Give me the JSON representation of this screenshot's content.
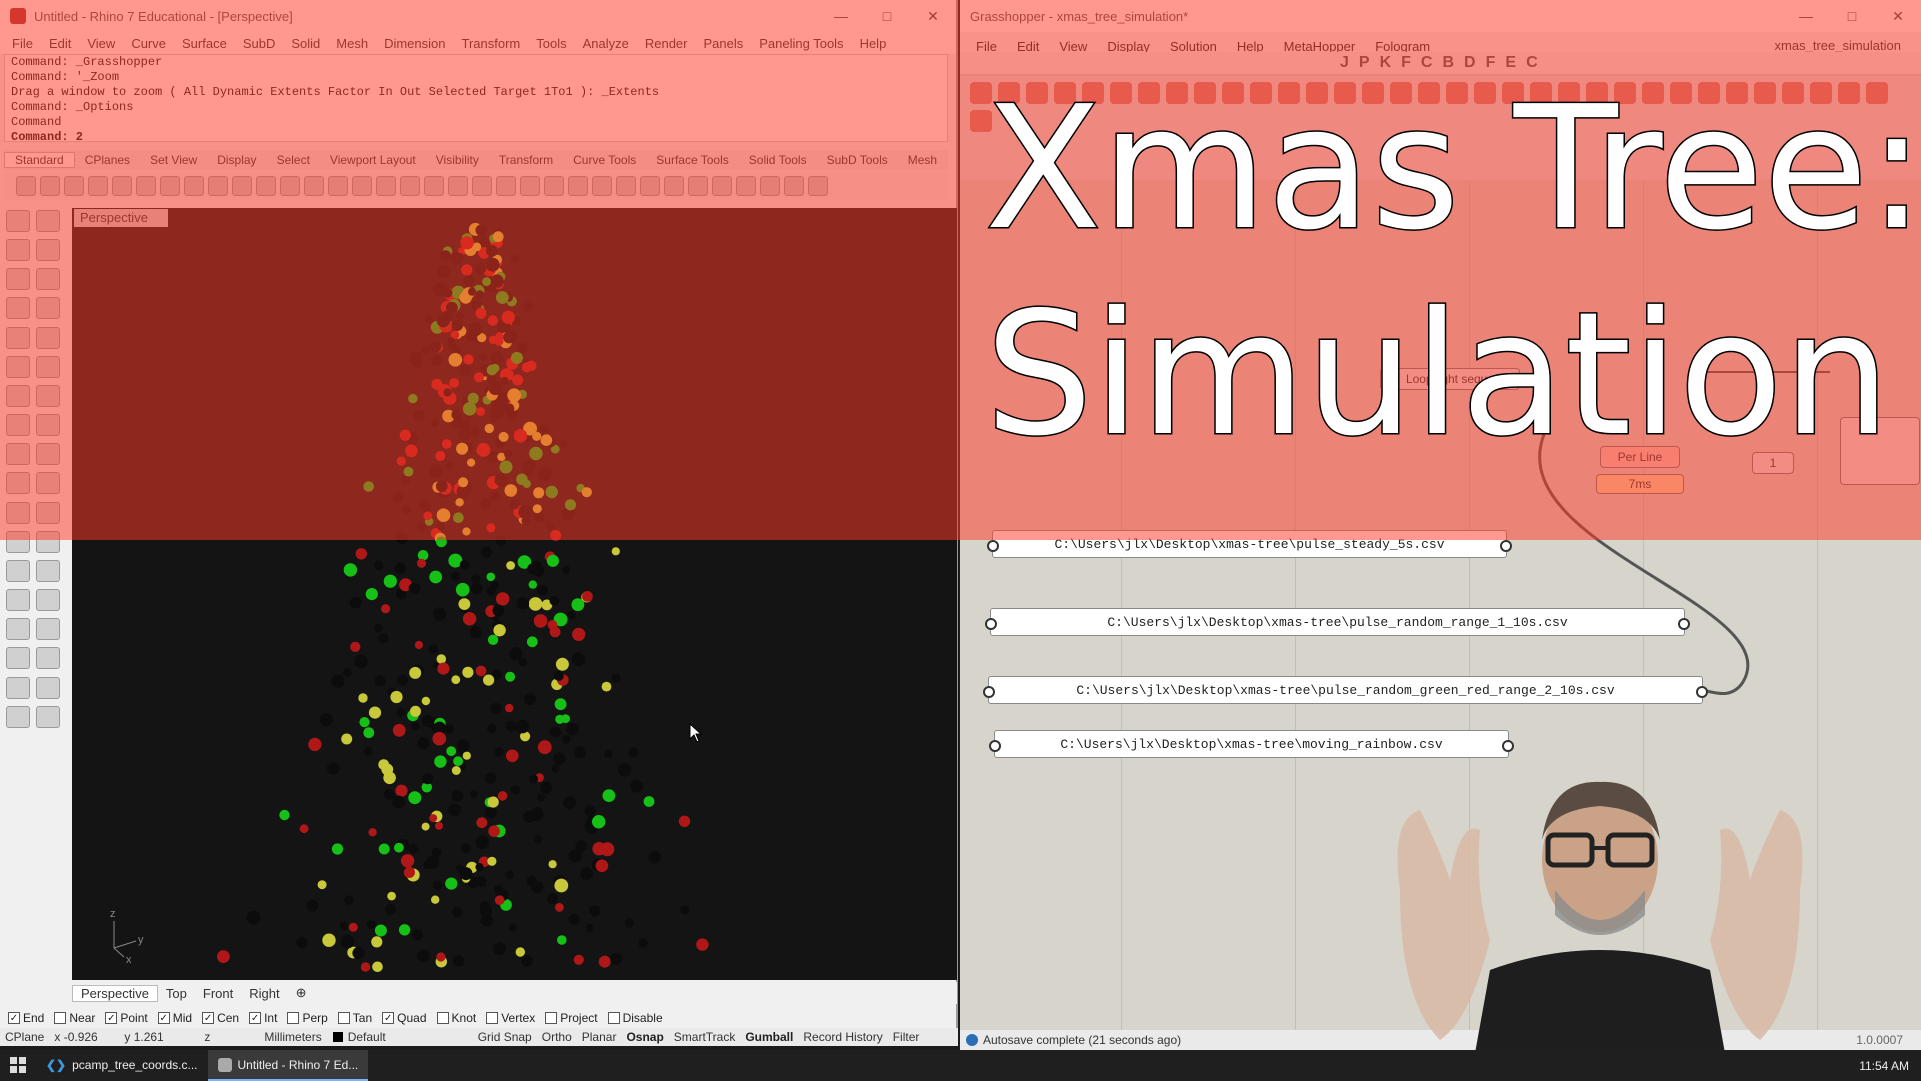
{
  "rhino": {
    "title": "Untitled - Rhino 7 Educational - [Perspective]",
    "menu": [
      "File",
      "Edit",
      "View",
      "Curve",
      "Surface",
      "SubD",
      "Solid",
      "Mesh",
      "Dimension",
      "Transform",
      "Tools",
      "Analyze",
      "Render",
      "Panels",
      "Paneling Tools",
      "Help"
    ],
    "command_lines": [
      "Command: _Grasshopper",
      "Command: '_Zoom",
      "Drag a window to zoom ( All  Dynamic  Extents  Factor  In  Out  Selected  Target  1To1 ):  _Extents",
      "Command: _Options",
      "Command"
    ],
    "command_prompt": "Command: 2",
    "toolbar_tabs": [
      "Standard",
      "CPlanes",
      "Set View",
      "Display",
      "Select",
      "Viewport Layout",
      "Visibility",
      "Transform",
      "Curve Tools",
      "Surface Tools",
      "Solid Tools",
      "SubD Tools",
      "Mesh"
    ],
    "viewport_label": "Perspective",
    "viewport_tabs": [
      "Perspective",
      "Top",
      "Front",
      "Right"
    ],
    "osnaps": [
      {
        "label": "End",
        "checked": true
      },
      {
        "label": "Near",
        "checked": false
      },
      {
        "label": "Point",
        "checked": true
      },
      {
        "label": "Mid",
        "checked": true
      },
      {
        "label": "Cen",
        "checked": true
      },
      {
        "label": "Int",
        "checked": true
      },
      {
        "label": "Perp",
        "checked": false
      },
      {
        "label": "Tan",
        "checked": false
      },
      {
        "label": "Quad",
        "checked": true
      },
      {
        "label": "Knot",
        "checked": false
      },
      {
        "label": "Vertex",
        "checked": false
      },
      {
        "label": "Project",
        "checked": false
      },
      {
        "label": "Disable",
        "checked": false
      }
    ],
    "status": {
      "cplane": "CPlane",
      "x": "x -0.926",
      "y": "y 1.261",
      "z": "z",
      "units": "Millimeters",
      "layer": "Default",
      "grid_snap": "Grid Snap",
      "ortho": "Ortho",
      "planar": "Planar",
      "osnap": "Osnap",
      "smarttrack": "SmartTrack",
      "gumball": "Gumball",
      "record_history": "Record History",
      "filter": "Filter"
    },
    "axis": {
      "z": "z",
      "y": "y",
      "x": "x"
    }
  },
  "grasshopper": {
    "title": "Grasshopper - xmas_tree_simulation*",
    "menu": [
      "File",
      "Edit",
      "View",
      "Display",
      "Solution",
      "Help",
      "MetaHopper",
      "Fologram"
    ],
    "document_name": "xmas_tree_simulation",
    "tabs": [
      "J",
      "P",
      "K",
      "F",
      "C",
      "B",
      "D",
      "F",
      "E",
      "C"
    ],
    "panels": [
      "C:\\Users\\jlx\\Desktop\\xmas-tree\\pulse_steady_5s.csv",
      "C:\\Users\\jlx\\Desktop\\xmas-tree\\pulse_random_range_1_10s.csv",
      "C:\\Users\\jlx\\Desktop\\xmas-tree\\pulse_random_green_red_range_2_10s.csv",
      "C:\\Users\\jlx\\Desktop\\xmas-tree\\moving_rainbow.csv"
    ],
    "component_per_line": "Per Line",
    "component_time": "7ms",
    "component_loop": "Loop light seque",
    "slider_value": "1",
    "status": "Autosave complete (21 seconds ago)",
    "version": "1.0.0007"
  },
  "overlay": {
    "title_line1": "Xmas Tree:",
    "title_line2": "Simulation",
    "band_color": "#ff3c28"
  },
  "taskbar": {
    "items": [
      "pcamp_tree_coords.c...",
      "Untitled - Rhino 7 Ed..."
    ],
    "time": "11:54 AM"
  }
}
